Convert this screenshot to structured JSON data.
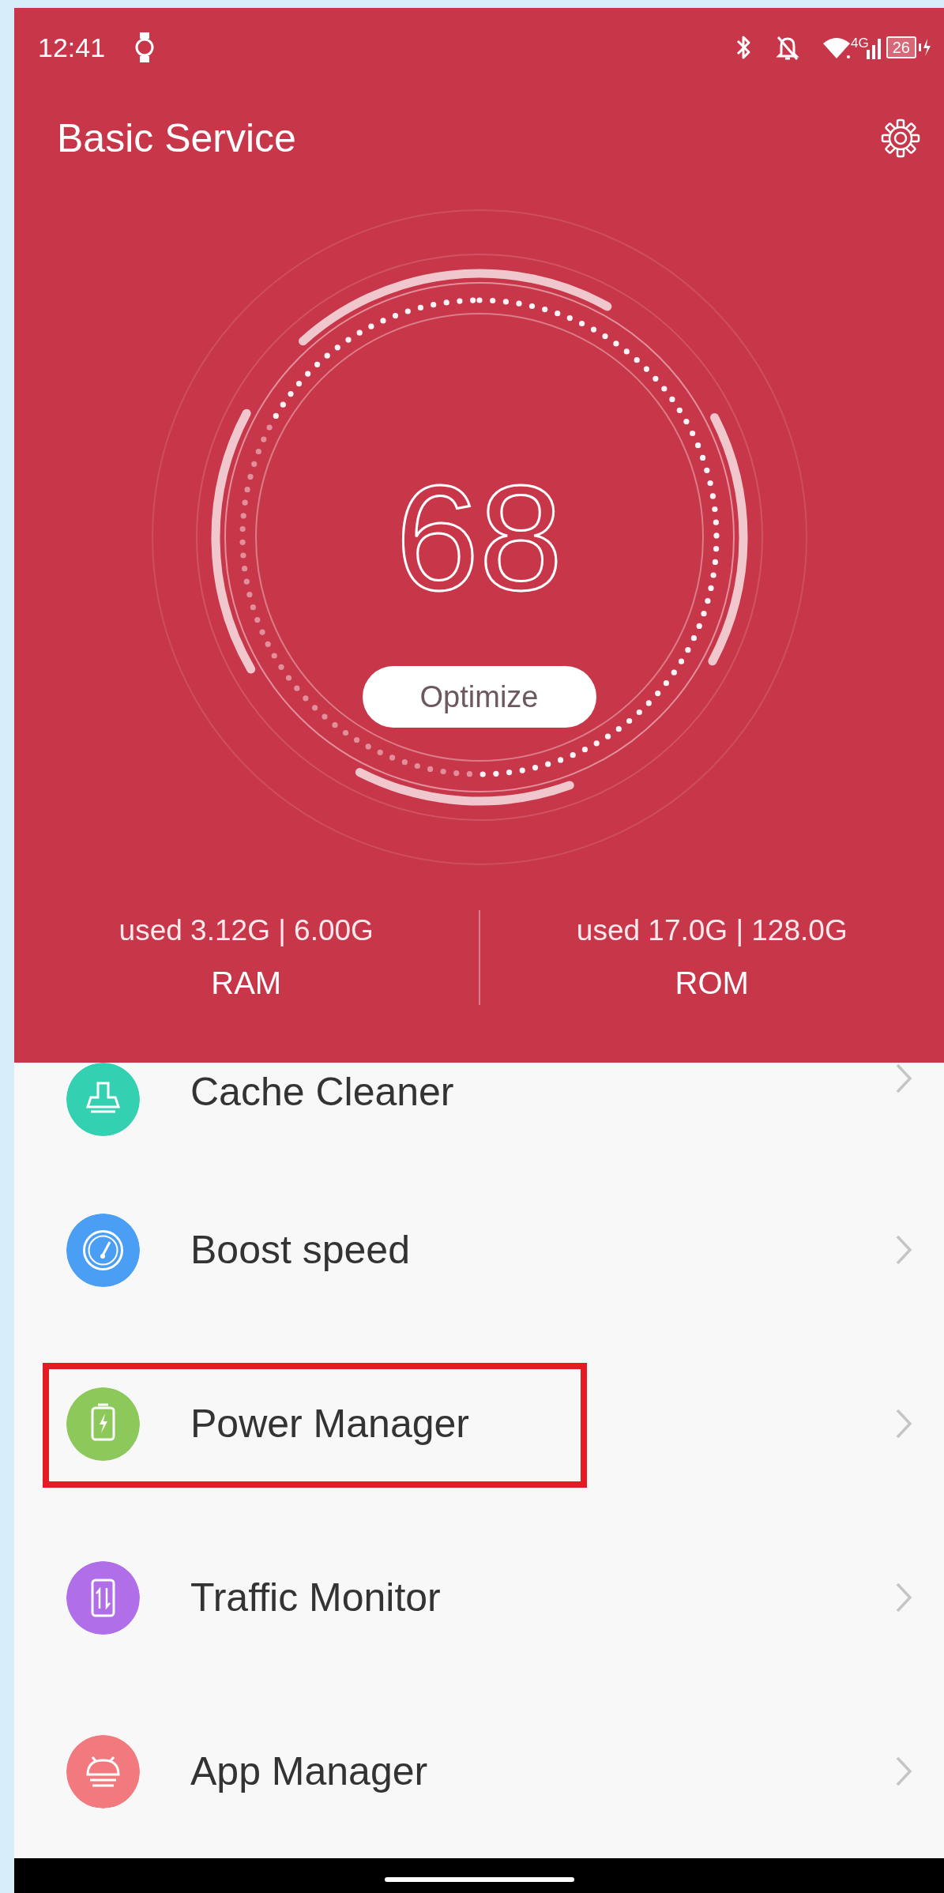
{
  "status_bar": {
    "time": "12:41",
    "network": "4G",
    "battery": "26"
  },
  "header": {
    "title": "Basic Service"
  },
  "gauge": {
    "score": "68",
    "button": "Optimize"
  },
  "memory": [
    {
      "usage": "used 3.12G | 6.00G",
      "label": "RAM"
    },
    {
      "usage": "used 17.0G | 128.0G",
      "label": "ROM"
    }
  ],
  "tools": [
    {
      "label": "Cache Cleaner",
      "kind": "broom",
      "color": "#33d1b2",
      "highlighted": false
    },
    {
      "label": "Boost speed",
      "kind": "speedometer",
      "color": "#4a9ff5",
      "highlighted": false
    },
    {
      "label": "Power Manager",
      "kind": "battery",
      "color": "#8cc85a",
      "highlighted": true
    },
    {
      "label": "Traffic Monitor",
      "kind": "phone-data",
      "color": "#b06fe8",
      "highlighted": false
    },
    {
      "label": "App Manager",
      "kind": "android",
      "color": "#f27a7f",
      "highlighted": false
    }
  ]
}
